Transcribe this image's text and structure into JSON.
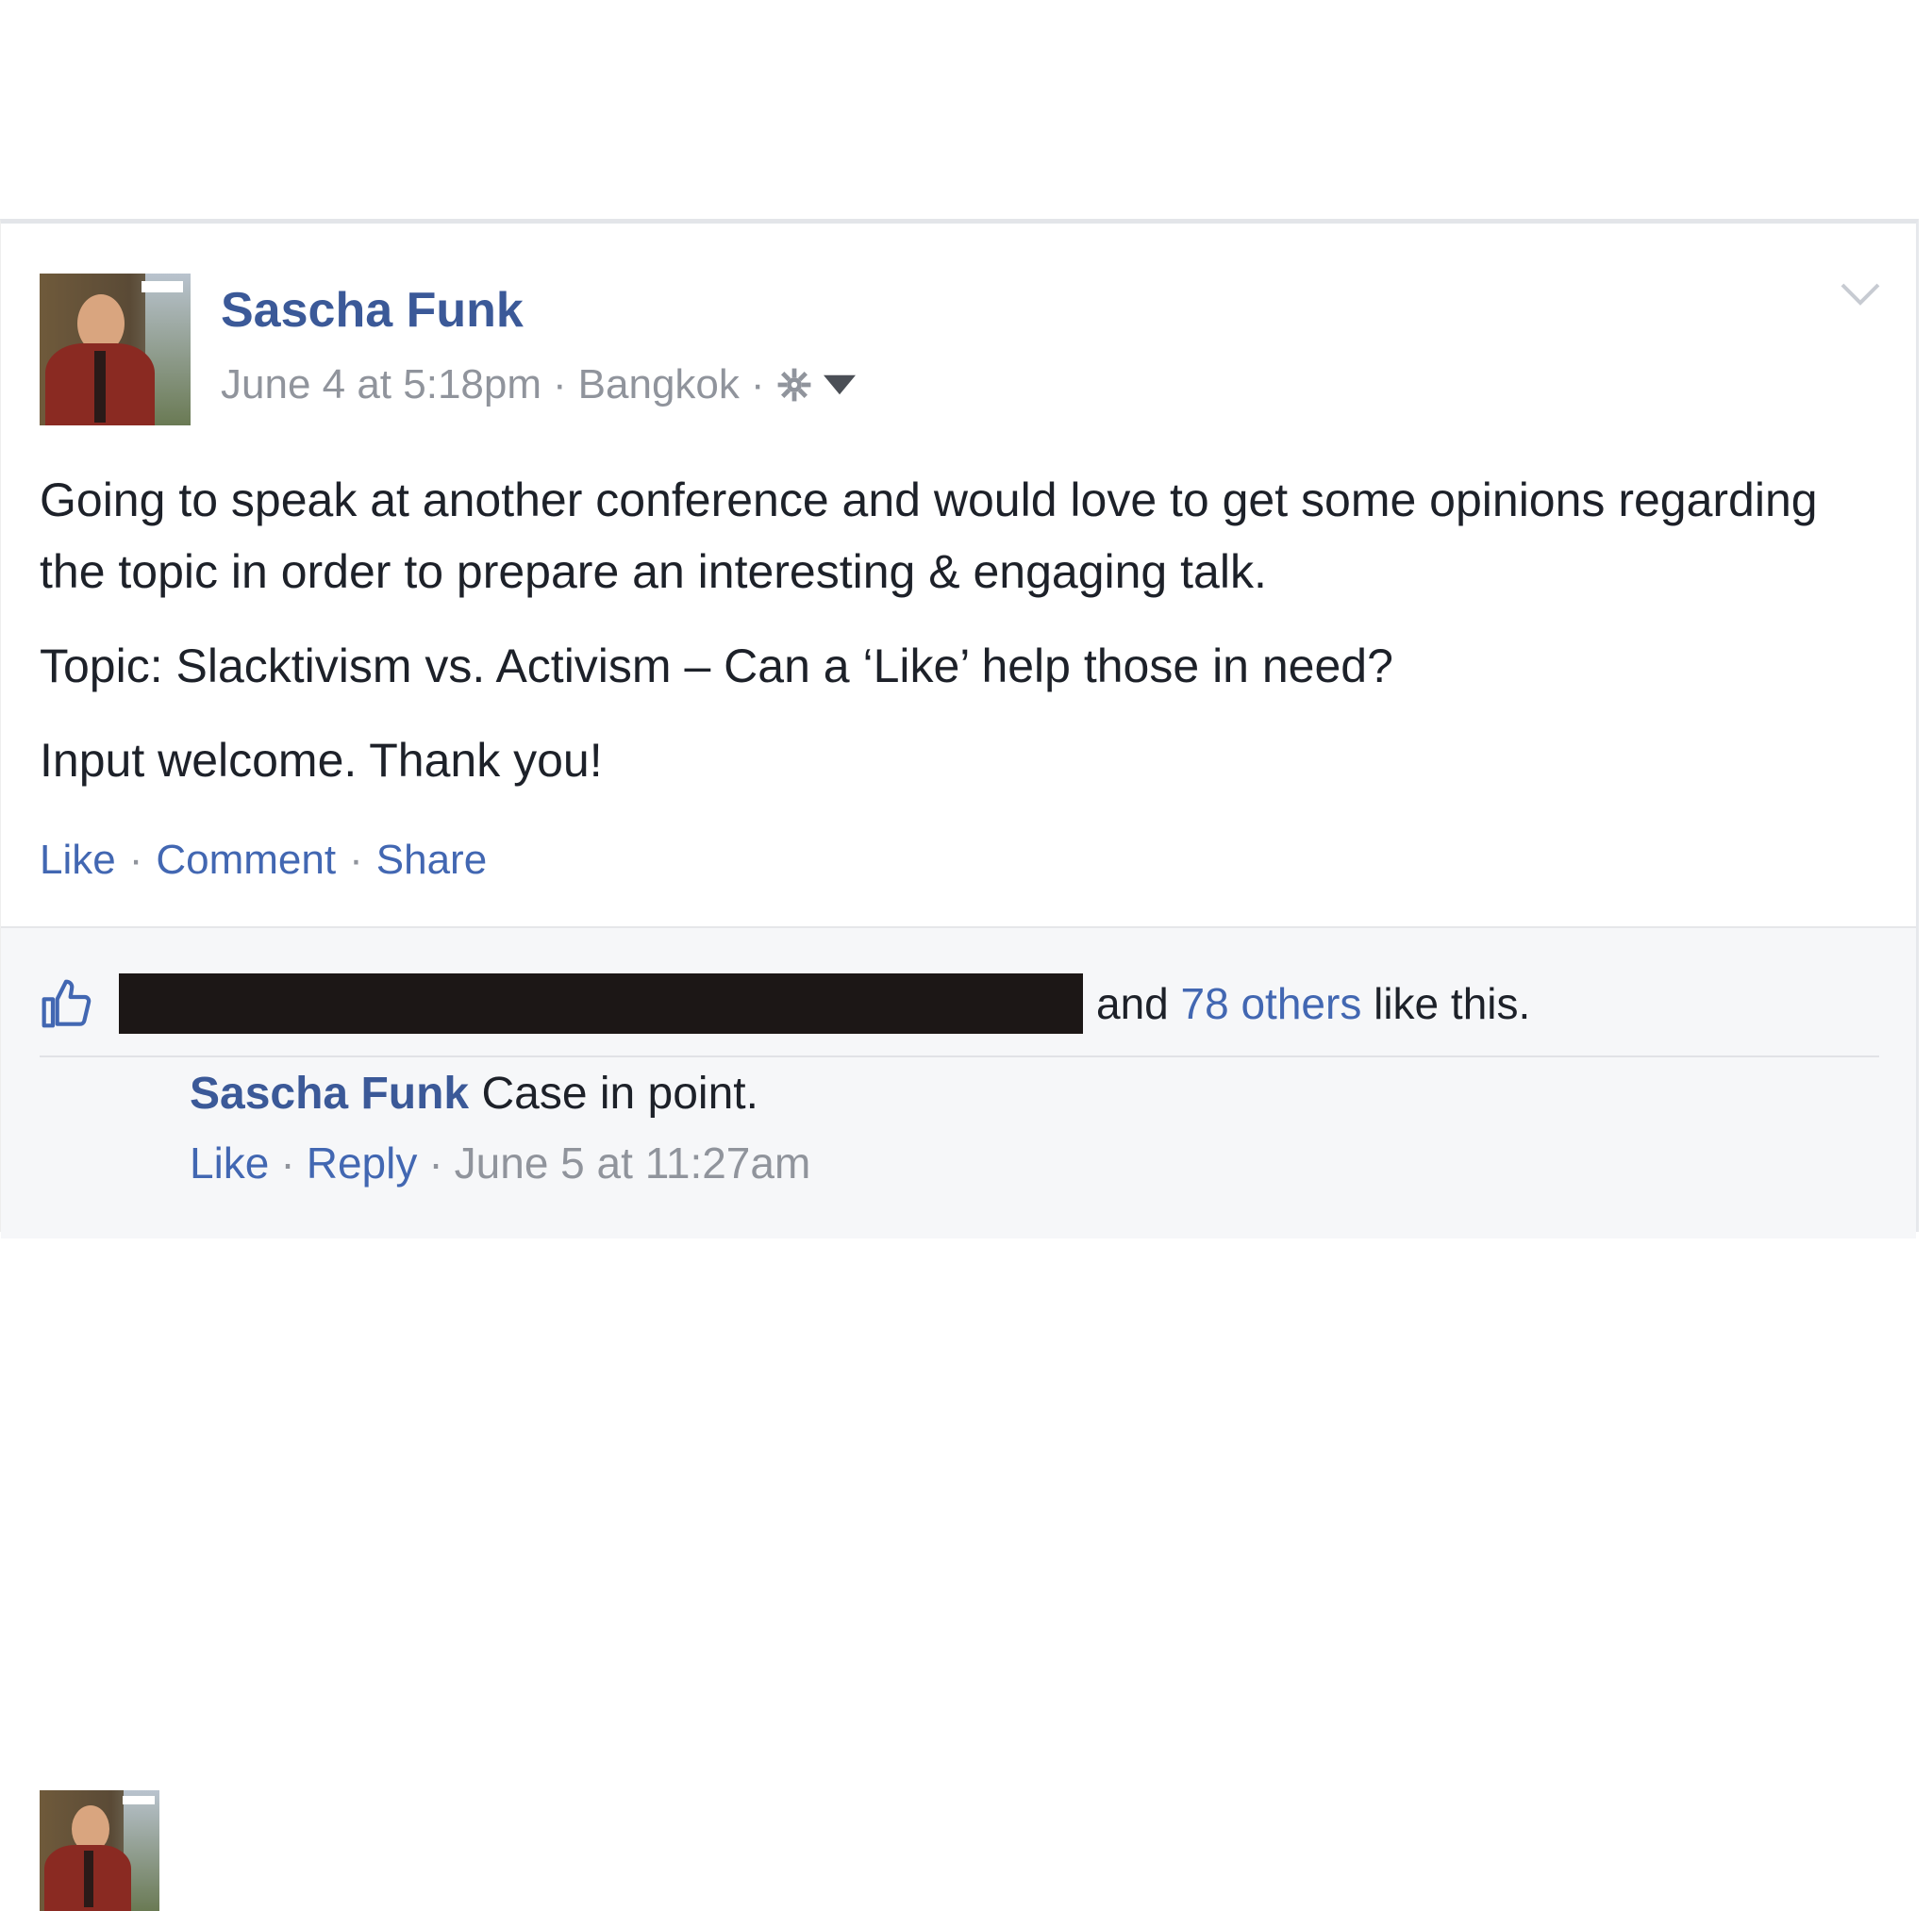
{
  "post": {
    "author": "Sascha Funk",
    "timestamp": "June 4 at 5:18pm",
    "separator": "·",
    "location": "Bangkok",
    "privacy_icon": "gear-icon",
    "audience_icon": "caret-down-icon",
    "menu_icon": "chevron-down-icon",
    "paragraphs": [
      "Going to speak at another conference and would love to get some opinions regarding the topic in order to prepare an interesting & engaging talk.",
      "Topic: Slacktivism vs. Activism – Can a ‘Like’ help those in need?",
      "Input welcome. Thank you!"
    ],
    "actions": {
      "like": "Like",
      "comment": "Comment",
      "share": "Share"
    }
  },
  "likes": {
    "icon": "thumbs-up-icon",
    "prefix": "and",
    "others_link": "78 others",
    "suffix": "like this."
  },
  "comment": {
    "author": "Sascha Funk",
    "text": "Case in point.",
    "like": "Like",
    "reply": "Reply",
    "timestamp": "June 5 at 11:27am"
  },
  "colors": {
    "link": "#4267b2",
    "name": "#3b5998",
    "meta": "#90949c",
    "text": "#1d2129",
    "redaction": "#1c1716"
  }
}
